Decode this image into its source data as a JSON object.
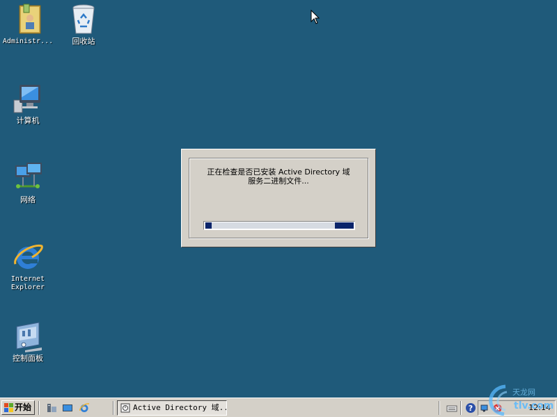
{
  "desktop": {
    "background": "#1f5a7a",
    "icons": [
      {
        "label": "Administr...",
        "icon": "user-folder-icon"
      },
      {
        "label": "回收站",
        "icon": "recycle-bin-icon"
      },
      {
        "label": "计算机",
        "icon": "computer-icon"
      },
      {
        "label": "网络",
        "icon": "network-icon"
      },
      {
        "label": "Internet\nExplorer",
        "icon": "internet-explorer-icon"
      },
      {
        "label": "控制面板",
        "icon": "control-panel-icon"
      }
    ]
  },
  "dialog": {
    "message_line1": "正在检查是否已安装 Active Directory 域",
    "message_line2": "服务二进制文件...",
    "progress_accent": "#0a246a"
  },
  "taskbar": {
    "start_label": "开始",
    "task_item_label": "Active Directory 域...",
    "clock": "12:14"
  },
  "watermark": {
    "text": "tlv.com",
    "text_cn": "天龙网"
  }
}
